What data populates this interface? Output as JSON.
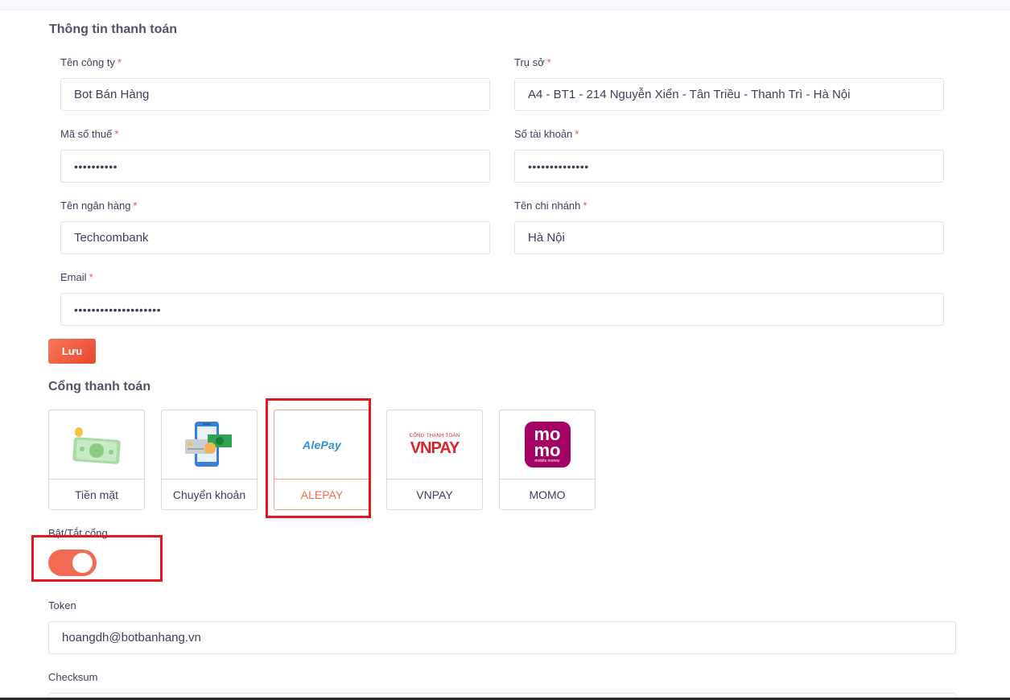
{
  "billing": {
    "title": "Thông tin thanh toán",
    "required_mark": "*",
    "company_name": {
      "label": "Tên công ty",
      "value": "Bot Bán Hàng"
    },
    "headquarters": {
      "label": "Trụ sở",
      "value": "A4 - BT1 - 214 Nguyễn Xiển - Tân Triều - Thanh Trì - Hà Nội"
    },
    "tax_code": {
      "label": "Mã số thuế",
      "value": "••••••••••"
    },
    "account_number": {
      "label": "Số tài khoản",
      "value": "••••••••••••••"
    },
    "bank_name": {
      "label": "Tên ngân hàng",
      "value": "Techcombank"
    },
    "branch_name": {
      "label": "Tên chi nhánh",
      "value": "Hà Nội"
    },
    "email": {
      "label": "Email",
      "value": "••••••••••••••••••••"
    },
    "save_label": "Lưu"
  },
  "gateways": {
    "title": "Cổng thanh toán",
    "items": [
      {
        "name": "Tiền mặt",
        "icon": "cash-icon"
      },
      {
        "name": "Chuyển khoản",
        "icon": "bank-transfer-icon"
      },
      {
        "name": "ALEPAY",
        "icon": "alepay-logo",
        "logo_text": "AlePay",
        "selected": true
      },
      {
        "name": "VNPAY",
        "icon": "vnpay-logo",
        "logo_small": "CỔNG THANH TOÁN",
        "logo_text": "VNPAY"
      },
      {
        "name": "MOMO",
        "icon": "momo-logo",
        "logo_top": "mo",
        "logo_bottom": "mo",
        "logo_small": "mobile money"
      }
    ]
  },
  "toggle": {
    "label": "Bật/Tắt cổng",
    "on": true
  },
  "token": {
    "label": "Token",
    "value": "hoangdh@botbanhang.vn"
  },
  "checksum": {
    "label": "Checksum",
    "value": ""
  },
  "colors": {
    "accent": "#f06b52",
    "highlight": "#e8141b",
    "required": "#e7515a"
  }
}
